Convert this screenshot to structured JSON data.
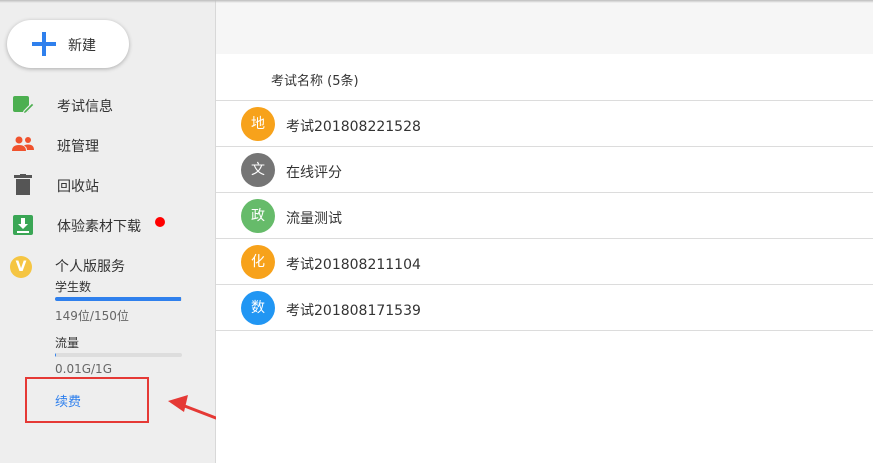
{
  "sidebar": {
    "new_label": "新建",
    "items": [
      {
        "label": "考试信息",
        "icon": "exam-info-icon"
      },
      {
        "label": "班管理",
        "icon": "class-group-icon"
      },
      {
        "label": "回收站",
        "icon": "trash-icon"
      },
      {
        "label": "体验素材下载",
        "icon": "download-icon",
        "badge": "red-dot"
      }
    ],
    "service": {
      "title": "个人版服务",
      "icon": "vip-v-icon",
      "icon_glyph": "V",
      "students_label": "学生数",
      "students_value": "149位/150位",
      "students_progress": 0.993,
      "traffic_label": "流量",
      "traffic_value": "0.01G/1G",
      "traffic_progress": 0.01,
      "renew_label": "续费"
    }
  },
  "main": {
    "header": "考试名称 (5条)",
    "rows": [
      {
        "avatar": "地",
        "color": "#f7a21b",
        "name": "考试201808221528"
      },
      {
        "avatar": "文",
        "color": "#757575",
        "name": "在线评分"
      },
      {
        "avatar": "政",
        "color": "#66bb6a",
        "name": "流量测试"
      },
      {
        "avatar": "化",
        "color": "#f7a21b",
        "name": "考试201808211104"
      },
      {
        "avatar": "数",
        "color": "#2196f3",
        "name": "考试201808171539"
      }
    ]
  },
  "colors": {
    "accent": "#2f80ed",
    "highlight": "#e53935"
  }
}
